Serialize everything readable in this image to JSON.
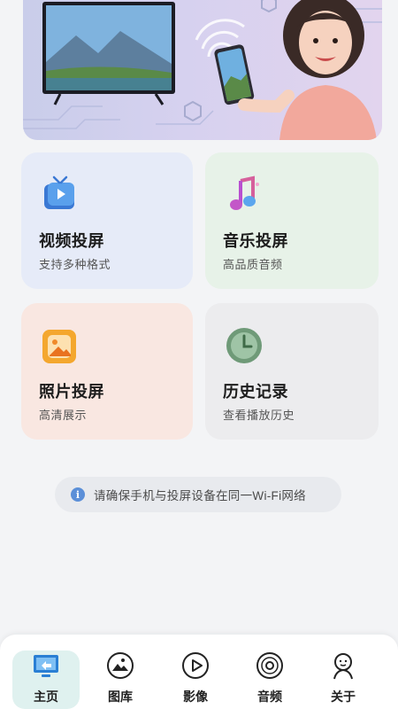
{
  "cards": {
    "video": {
      "title": "视频投屏",
      "subtitle": "支持多种格式"
    },
    "music": {
      "title": "音乐投屏",
      "subtitle": "高品质音频"
    },
    "photo": {
      "title": "照片投屏",
      "subtitle": "高清展示"
    },
    "history": {
      "title": "历史记录",
      "subtitle": "查看播放历史"
    }
  },
  "notice": {
    "icon": "info-icon",
    "text": "请确保手机与投屏设备在同一Wi-Fi网络"
  },
  "nav": {
    "items": [
      {
        "label": "主页",
        "icon": "cast-screen-icon",
        "active": true
      },
      {
        "label": "图库",
        "icon": "gallery-icon"
      },
      {
        "label": "影像",
        "icon": "play-icon"
      },
      {
        "label": "音频",
        "icon": "disc-icon"
      },
      {
        "label": "关于",
        "icon": "person-icon"
      }
    ]
  },
  "colors": {
    "accent": "#2a7fd4",
    "active_nav_bg": "#dff1ef",
    "video_card": "#e6ebf8",
    "music_card": "#e7f2e8",
    "photo_card": "#f9e7e1",
    "history_card": "#ececee"
  }
}
